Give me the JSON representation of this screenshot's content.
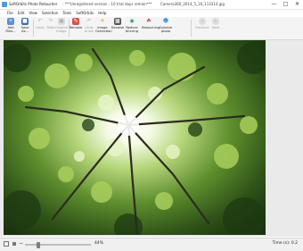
{
  "window": {
    "app_name": "SoftOrbits Photo Retoucher",
    "registration_note": "- ***Unregistered version - 10 trial days remain***",
    "file_name": "Camera360_2014_5_16_113314.jpg"
  },
  "menu": [
    "File",
    "Edit",
    "View",
    "Selection",
    "Tools",
    "SoftOrbits",
    "Help"
  ],
  "toolbar": {
    "buttons": [
      {
        "label": "Add Files...",
        "icon": "add-image-icon",
        "enabled": true
      },
      {
        "label": "Save As...",
        "icon": "save-icon",
        "enabled": true
      },
      {
        "label": "Undo",
        "icon": "undo-icon",
        "enabled": false
      },
      {
        "label": "Redo",
        "icon": "redo-icon",
        "enabled": false
      },
      {
        "label": "Original image",
        "icon": "original-image-icon",
        "enabled": false
      },
      {
        "label": "Remove",
        "icon": "eraser-icon",
        "enabled": true
      },
      {
        "label": "Undo brush",
        "icon": "undo-brush-icon",
        "enabled": false
      },
      {
        "label": "Image Correction",
        "icon": "sun-icon",
        "enabled": true
      },
      {
        "label": "Denoise",
        "icon": "denoise-icon",
        "enabled": true
      },
      {
        "label": "Reduce blurring",
        "icon": "reduce-blur-icon",
        "enabled": true
      },
      {
        "label": "Retouching",
        "icon": "retouch-icon",
        "enabled": true
      },
      {
        "label": "Colorize photo",
        "icon": "colorize-icon",
        "enabled": true
      },
      {
        "label": "Previous",
        "icon": "previous-icon",
        "enabled": false
      },
      {
        "label": "Next",
        "icon": "next-icon",
        "enabled": false
      }
    ]
  },
  "status": {
    "zoom": "44%",
    "time": "Time (s): 0.2",
    "slider_position": 0.18
  },
  "colors": {
    "toolbar_bg": "#f4f4f4",
    "accent": "#4a9fd8"
  }
}
